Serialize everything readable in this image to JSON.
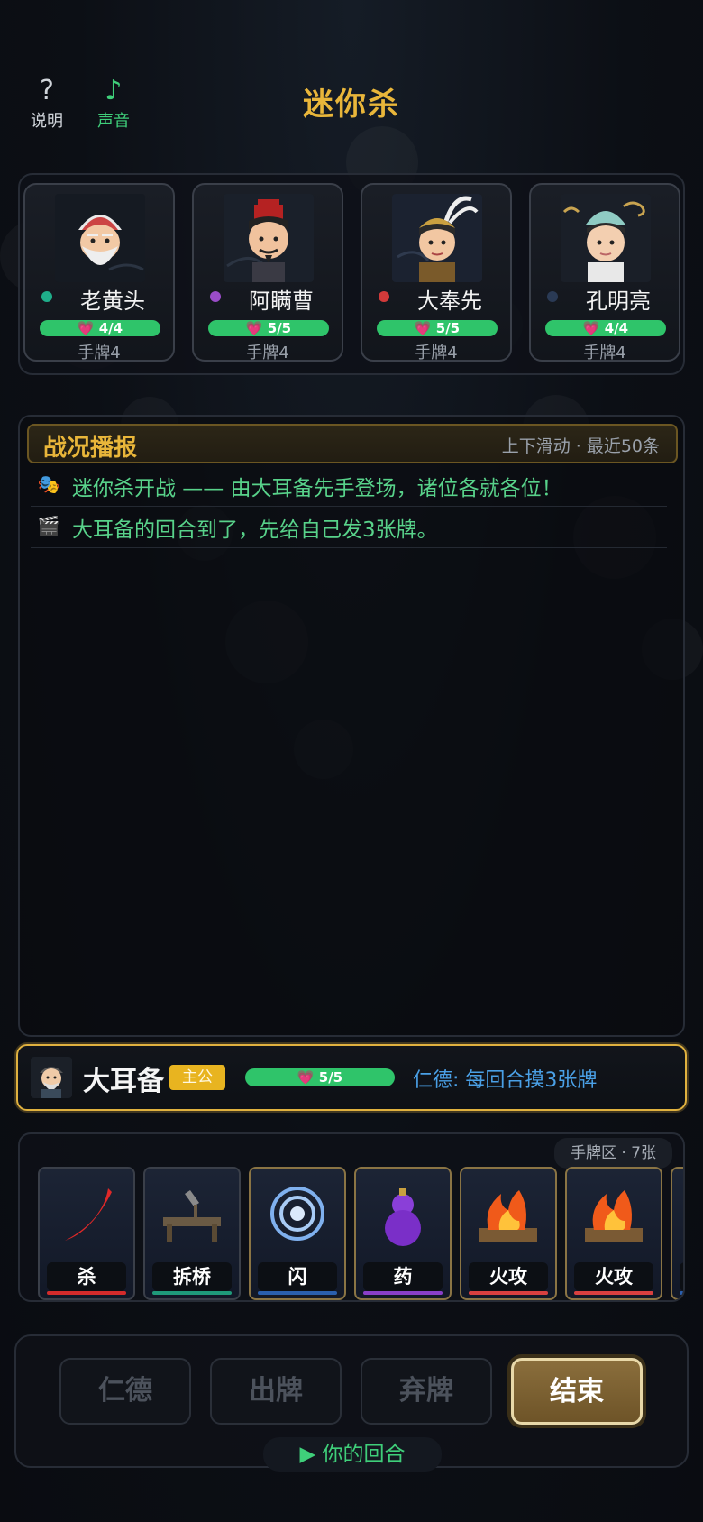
{
  "header": {
    "title": "迷你杀",
    "help_label": "说明",
    "help_icon": "?",
    "sound_label": "声音",
    "sound_icon": "♪"
  },
  "players": [
    {
      "name": "老黄头",
      "dot_color": "#1fae8a",
      "hp": "💗 4/4",
      "hand": "手牌4"
    },
    {
      "name": "阿瞒曹",
      "dot_color": "#9a4cc8",
      "hp": "💗 5/5",
      "hand": "手牌4"
    },
    {
      "name": "大奉先",
      "dot_color": "#d23a3a",
      "hp": "💗 5/5",
      "hand": "手牌4"
    },
    {
      "name": "孔明亮",
      "dot_color": "#2a3a55",
      "hp": "💗 4/4",
      "hand": "手牌4"
    }
  ],
  "log": {
    "title": "战况播报",
    "hint": "上下滑动 · 最近50条",
    "entries": [
      {
        "icon": "🎭",
        "text": "迷你杀开战 —— 由大耳备先手登场，诸位各就各位！"
      },
      {
        "icon": "🎬",
        "text": "大耳备的回合到了，先给自己发3张牌。"
      }
    ]
  },
  "lord": {
    "name": "大耳备",
    "badge": "主公",
    "hp": "💗 5/5",
    "skill": "仁德: 每回合摸3张牌"
  },
  "hand": {
    "label": "手牌区 · 7张",
    "cards": [
      {
        "name": "杀",
        "icon": "blade-icon",
        "stripe": "#d42b2b"
      },
      {
        "name": "拆桥",
        "icon": "bridge-icon",
        "stripe": "#1f9a7a"
      },
      {
        "name": "闪",
        "icon": "swirl-icon",
        "stripe": "#2a5fae"
      },
      {
        "name": "药",
        "icon": "gourd-icon",
        "stripe": "#8a3fc8"
      },
      {
        "name": "火攻",
        "icon": "fire-icon",
        "stripe": "#d84040"
      },
      {
        "name": "火攻",
        "icon": "fire-icon",
        "stripe": "#d84040"
      },
      {
        "name": "",
        "icon": "swirl-icon",
        "stripe": "#2a5fae"
      }
    ]
  },
  "actions": {
    "rende": "仁德",
    "play": "出牌",
    "discard": "弃牌",
    "end": "结束",
    "turn_status": "▶ 你的回合"
  }
}
